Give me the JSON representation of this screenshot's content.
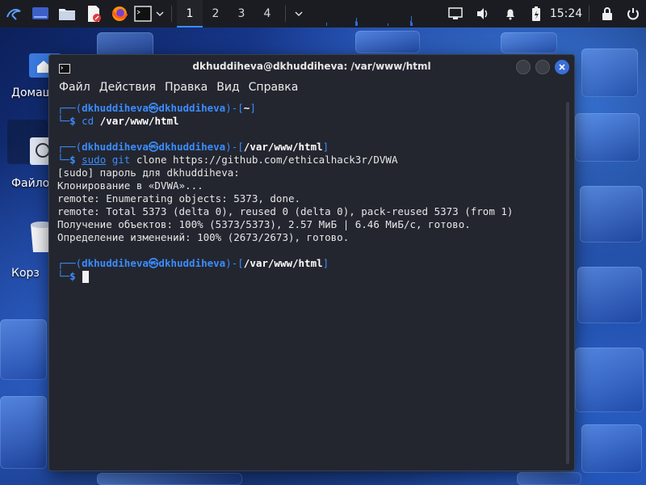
{
  "panel": {
    "workspaces": [
      "1",
      "2",
      "3",
      "4"
    ],
    "active_workspace": "1",
    "clock": "15:24"
  },
  "desktop": {
    "icons": [
      {
        "label": "Домаш"
      },
      {
        "label": "Файлов"
      },
      {
        "label": "Корз"
      }
    ]
  },
  "window": {
    "title": "dkhuddiheva@dkhuddiheva: /var/www/html",
    "menu": [
      "Файл",
      "Действия",
      "Правка",
      "Вид",
      "Справка"
    ]
  },
  "terminal": {
    "user": "dkhuddiheva",
    "at": "㉿",
    "host": "dkhuddiheva",
    "prompt1": {
      "path": "~",
      "cmd_word": "cd",
      "cmd_rest": " /var/www/html"
    },
    "prompt2": {
      "path": "/var/www/html",
      "cmd_sudo": "sudo",
      "cmd_git": " git",
      "cmd_rest": " clone https://github.com/ethicalhack3r/DVWA"
    },
    "output": [
      "[sudo] пароль для dkhuddiheva:",
      "Клонирование в «DVWA»...",
      "remote: Enumerating objects: 5373, done.",
      "remote: Total 5373 (delta 0), reused 0 (delta 0), pack-reused 5373 (from 1)",
      "Получение объектов: 100% (5373/5373), 2.57 МиБ | 6.46 МиБ/с, готово.",
      "Определение изменений: 100% (2673/2673), готово."
    ],
    "prompt3": {
      "path": "/var/www/html"
    },
    "dollar": "$"
  }
}
